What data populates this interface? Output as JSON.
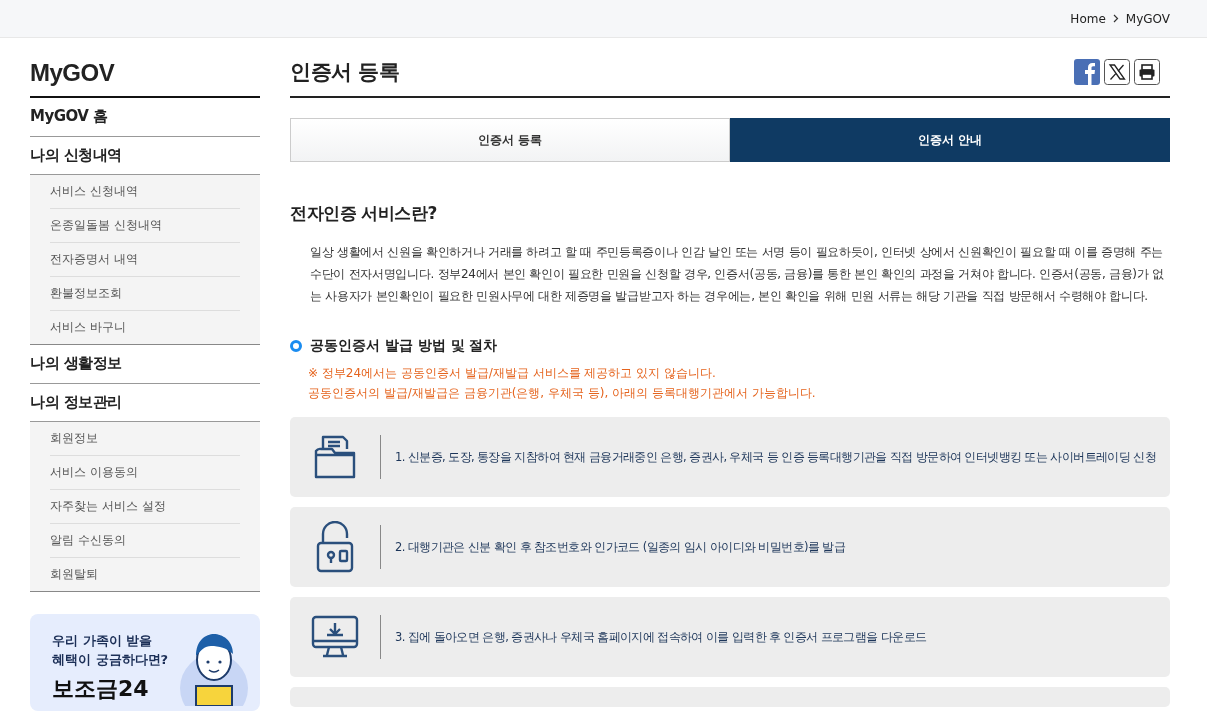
{
  "breadcrumb": [
    {
      "label": "Home"
    },
    {
      "label": "MyGOV"
    }
  ],
  "sidebar": {
    "title": "MyGOV",
    "groups": [
      {
        "label": "MyGOV 홈"
      },
      {
        "label": "나의 신청내역",
        "children": [
          {
            "label": "서비스 신청내역"
          },
          {
            "label": "온종일돌봄 신청내역"
          },
          {
            "label": "전자증명서 내역"
          },
          {
            "label": "환불정보조회"
          },
          {
            "label": "서비스 바구니"
          }
        ]
      },
      {
        "label": "나의 생활정보"
      },
      {
        "label": "나의 정보관리",
        "children": [
          {
            "label": "회원정보"
          },
          {
            "label": "서비스 이용동의"
          },
          {
            "label": "자주찾는 서비스 설정"
          },
          {
            "label": "알림 수신동의"
          },
          {
            "label": "회원탈퇴"
          }
        ]
      }
    ],
    "banner": {
      "lines": [
        "우리 가족이 받을",
        "혜택이 궁금하다면?"
      ],
      "title": "보조금24"
    }
  },
  "page_title": "인증서 등록",
  "share_buttons": [
    {
      "kind": "facebook"
    },
    {
      "kind": "x"
    },
    {
      "kind": "print"
    }
  ],
  "tabs": [
    {
      "label": "인증서 등록",
      "selected": false
    },
    {
      "label": "인증서 안내",
      "selected": true
    }
  ],
  "section_title": "전자인증 서비스란?",
  "intro": "일상 생활에서 신원을 확인하거나 거래를 하려고 할 때 주민등록증이나 인감 날인 또는 서명 등이 필요하듯이, 인터넷 상에서 신원확인이 필요할 때 이를 증명해 주는 수단이 전자서명입니다. 정부24에서 본인 확인이 필요한 민원을 신청할 경우, 인증서(공동, 금융)를 통한 본인 확인의 과정을 거쳐야 합니다. 인증서(공동, 금융)가 없는 사용자가 본인확인이 필요한 민원사무에 대한 제증명을 발급받고자 하는 경우에는, 본인 확인을 위해 민원 서류는 해당 기관을 직접 방문해서 수령해야 합니다.",
  "subsection": {
    "title": "공동인증서 발급 방법 및 절차",
    "notices": [
      "※ 정부24에서는 공동인증서 발급/재발급 서비스를 제공하고 있지 않습니다.",
      "공동인증서의 발급/재발급은 금융기관(은행, 우체국 등), 아래의 등록대행기관에서 가능합니다."
    ],
    "steps": [
      {
        "kind": "folder",
        "text": "1. 신분증, 도장, 통장을 지참하여 현재 금융거래중인 은행, 증권사, 우체국 등 인증 등록대행기관을 직접 방문하여 인터넷뱅킹 또는 사이버트레이딩 신청"
      },
      {
        "kind": "lock",
        "text": "2. 대행기관은 신분 확인 후 참조번호와 인가코드 (일종의 임시 아이디와 비밀번호)를 발급"
      },
      {
        "kind": "monitor",
        "text": "3. 집에 돌아오면 은행, 증권사나 우체국 홈페이지에 접속하여 이를 입력한 후 인증서 프로그램을 다운로드"
      }
    ]
  }
}
